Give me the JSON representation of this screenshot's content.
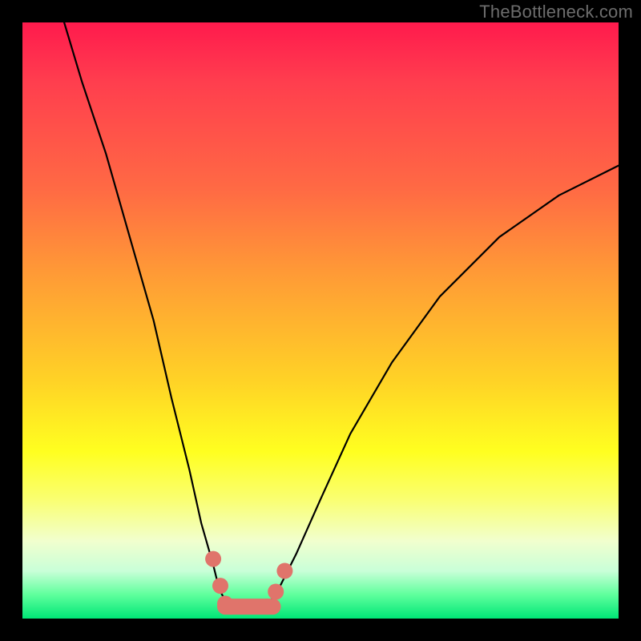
{
  "watermark": "TheBottleneck.com",
  "chart_data": {
    "type": "line",
    "title": "",
    "xlabel": "",
    "ylabel": "",
    "xlim": [
      0,
      100
    ],
    "ylim": [
      0,
      100
    ],
    "grid": false,
    "legend": false,
    "series": [
      {
        "name": "left-curve",
        "x": [
          7,
          10,
          14,
          18,
          22,
          25,
          28,
          30,
          32,
          33,
          34,
          35
        ],
        "values": [
          100,
          90,
          78,
          64,
          50,
          37,
          25,
          16,
          9,
          5,
          3,
          2
        ]
      },
      {
        "name": "right-curve",
        "x": [
          41,
          43,
          46,
          50,
          55,
          62,
          70,
          80,
          90,
          100
        ],
        "values": [
          2,
          5,
          11,
          20,
          31,
          43,
          54,
          64,
          71,
          76
        ]
      },
      {
        "name": "valley-floor",
        "x": [
          34,
          42
        ],
        "values": [
          2,
          2
        ]
      }
    ],
    "markers": [
      {
        "x": 32.0,
        "y": 10.0
      },
      {
        "x": 33.2,
        "y": 5.5
      },
      {
        "x": 34.0,
        "y": 2.5
      },
      {
        "x": 35.0,
        "y": 2.0
      },
      {
        "x": 41.0,
        "y": 2.0
      },
      {
        "x": 42.5,
        "y": 4.5
      },
      {
        "x": 44.0,
        "y": 8.0
      }
    ],
    "colors": {
      "line": "#000000",
      "marker": "#e0746b"
    }
  }
}
